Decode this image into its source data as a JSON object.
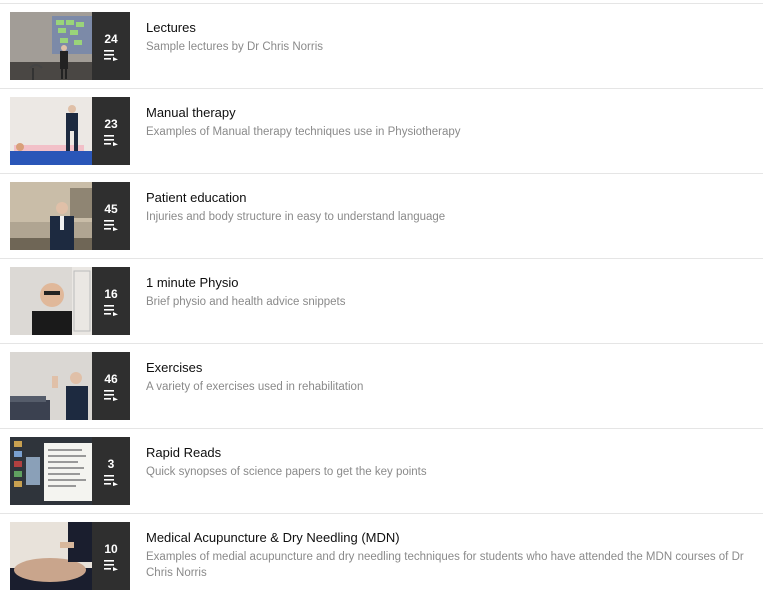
{
  "playlists": [
    {
      "title": "Lectures",
      "description": "Sample lectures by Dr Chris Norris",
      "count": "24",
      "thumbnail_scene": "lecture-presentation",
      "colors": {
        "bg": "#7a7670",
        "accent": "#9ad47a"
      }
    },
    {
      "title": "Manual therapy",
      "description": "Examples of Manual therapy techniques use in Physiotherapy",
      "count": "23",
      "thumbnail_scene": "therapist-patient-on-table",
      "colors": {
        "bg": "#e8e4e0",
        "accent": "#2a56b8"
      }
    },
    {
      "title": "Patient education",
      "description": "Injuries and body structure in easy to understand language",
      "count": "45",
      "thumbnail_scene": "presenter-in-room",
      "colors": {
        "bg": "#a89b88",
        "accent": "#1d2a40"
      }
    },
    {
      "title": "1 minute Physio",
      "description": "Brief physio and health advice snippets",
      "count": "16",
      "thumbnail_scene": "presenter-closeup",
      "colors": {
        "bg": "#d6d3cf",
        "accent": "#1a1a1a"
      }
    },
    {
      "title": "Exercises",
      "description": "A variety of exercises used in rehabilitation",
      "count": "46",
      "thumbnail_scene": "presenter-waving",
      "colors": {
        "bg": "#d9d6d2",
        "accent": "#1d2a40"
      }
    },
    {
      "title": "Rapid Reads",
      "description": "Quick synopses of science papers to get the key points",
      "count": "3",
      "thumbnail_scene": "screen-with-document",
      "colors": {
        "bg": "#3a3f47",
        "accent": "#f4f4f0"
      }
    },
    {
      "title": "Medical Acupuncture & Dry Needling (MDN)",
      "description": "Examples of medial acupuncture and dry needling techniques for students who have attended the MDN courses of Dr Chris Norris",
      "count": "10",
      "thumbnail_scene": "back-treatment",
      "colors": {
        "bg": "#c9a58c",
        "accent": "#1a1e2e"
      }
    }
  ],
  "icons": {
    "playlist": "playlist-play-icon"
  }
}
